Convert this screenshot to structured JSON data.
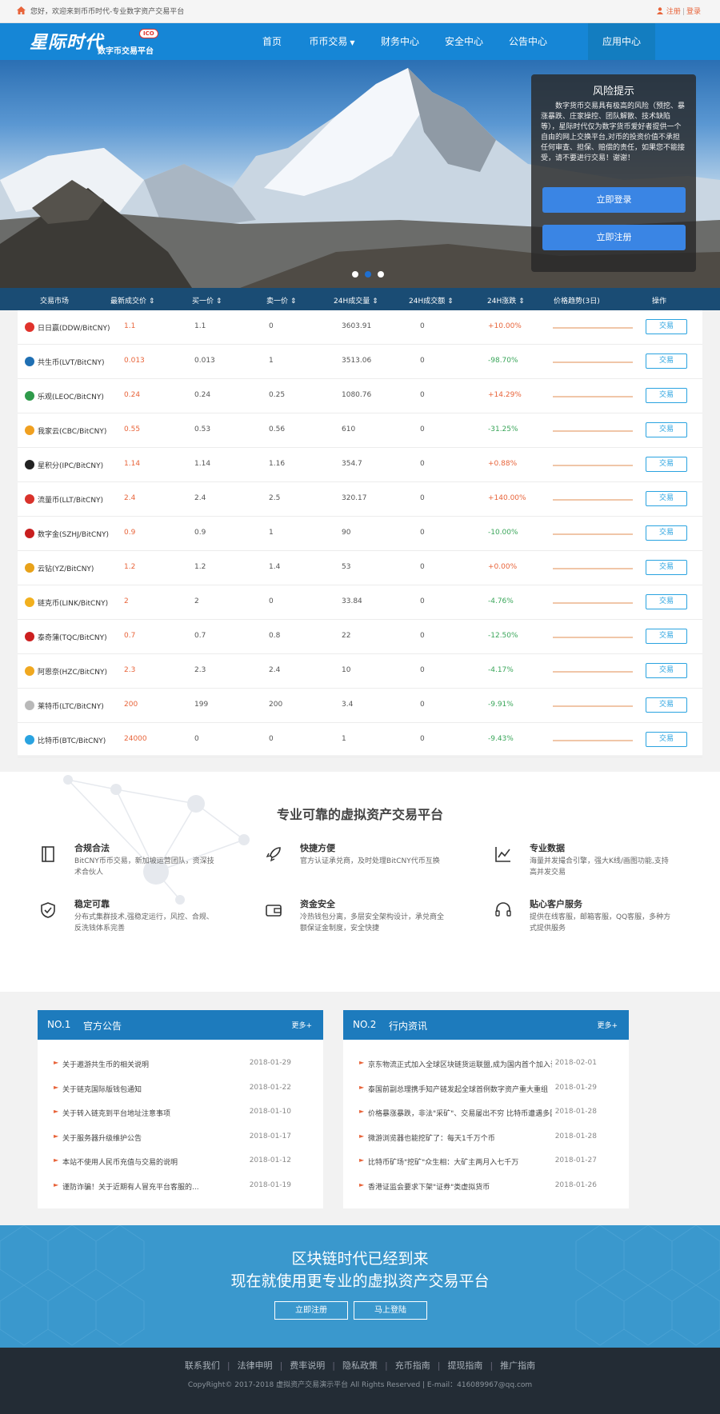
{
  "topbar": {
    "welcome": "您好，欢迎来到币币时代-专业数字资产交易平台",
    "register": "注册",
    "login": "登录"
  },
  "nav": {
    "logo_main": "星际时代",
    "logo_sub": "数字币交易平台",
    "logo_badge": "ICO",
    "items": [
      "首页",
      "币币交易",
      "财务中心",
      "安全中心",
      "公告中心",
      "应用中心"
    ]
  },
  "hero": {
    "risk_title": "风险提示",
    "risk_text": "数字货币交易具有极高的风险（预挖、暴涨暴跌、庄家操控、团队解散、技术缺陷等），星际时代仅为数字货币爱好者提供一个自由的网上交换平台,对币的投资价值不承担任何审查、担保、赔偿的责任，如果您不能接受，请不要进行交易！谢谢！",
    "login_button": "立即登录",
    "register_button": "立即注册"
  },
  "market": {
    "headers": [
      "交易市场",
      "最新成交价 ⇕",
      "买一价 ⇕",
      "卖一价 ⇕",
      "24H成交量 ⇕",
      "24H成交额 ⇕",
      "24H涨跌 ⇕",
      "价格趋势(3日)",
      "操作"
    ],
    "trade_label": "交易",
    "rows": [
      {
        "name": "日日赢(DDW/BitCNY)",
        "last": "1.1",
        "buy": "1.1",
        "sell": "0",
        "vol": "3603.91",
        "amt": "0",
        "chg": "+10.00%",
        "dir": "up",
        "color": "#e0332c"
      },
      {
        "name": "共生币(LVT/BitCNY)",
        "last": "0.013",
        "buy": "0.013",
        "sell": "1",
        "vol": "3513.06",
        "amt": "0",
        "chg": "-98.70%",
        "dir": "down",
        "color": "#1f6fb3"
      },
      {
        "name": "乐观(LEOC/BitCNY)",
        "last": "0.24",
        "buy": "0.24",
        "sell": "0.25",
        "vol": "1080.76",
        "amt": "0",
        "chg": "+14.29%",
        "dir": "up",
        "color": "#2e9a4a"
      },
      {
        "name": "我家云(CBC/BitCNY)",
        "last": "0.55",
        "buy": "0.53",
        "sell": "0.56",
        "vol": "610",
        "amt": "0",
        "chg": "-31.25%",
        "dir": "down",
        "color": "#f0a020"
      },
      {
        "name": "星积分(IPC/BitCNY)",
        "last": "1.14",
        "buy": "1.14",
        "sell": "1.16",
        "vol": "354.7",
        "amt": "0",
        "chg": "+0.88%",
        "dir": "up",
        "color": "#222222"
      },
      {
        "name": "流量币(LLT/BitCNY)",
        "last": "2.4",
        "buy": "2.4",
        "sell": "2.5",
        "vol": "320.17",
        "amt": "0",
        "chg": "+140.00%",
        "dir": "up",
        "color": "#d9322b"
      },
      {
        "name": "数字金(SZHJ/BitCNY)",
        "last": "0.9",
        "buy": "0.9",
        "sell": "1",
        "vol": "90",
        "amt": "0",
        "chg": "-10.00%",
        "dir": "down",
        "color": "#c81e1e"
      },
      {
        "name": "云钻(YZ/BitCNY)",
        "last": "1.2",
        "buy": "1.2",
        "sell": "1.4",
        "vol": "53",
        "amt": "0",
        "chg": "+0.00%",
        "dir": "up",
        "color": "#e8a21a"
      },
      {
        "name": "链克币(LINK/BitCNY)",
        "last": "2",
        "buy": "2",
        "sell": "0",
        "vol": "33.84",
        "amt": "0",
        "chg": "-4.76%",
        "dir": "down",
        "color": "#f2b01e"
      },
      {
        "name": "泰奇蒲(TQC/BitCNY)",
        "last": "0.7",
        "buy": "0.7",
        "sell": "0.8",
        "vol": "22",
        "amt": "0",
        "chg": "-12.50%",
        "dir": "down",
        "color": "#cc1f1f"
      },
      {
        "name": "阿恩奈(HZC/BitCNY)",
        "last": "2.3",
        "buy": "2.3",
        "sell": "2.4",
        "vol": "10",
        "amt": "0",
        "chg": "-4.17%",
        "dir": "down",
        "color": "#f0a820"
      },
      {
        "name": "莱特币(LTC/BitCNY)",
        "last": "200",
        "buy": "199",
        "sell": "200",
        "vol": "3.4",
        "amt": "0",
        "chg": "-9.91%",
        "dir": "down",
        "color": "#b9b9b9"
      },
      {
        "name": "比特币(BTC/BitCNY)",
        "last": "24000",
        "buy": "0",
        "sell": "0",
        "vol": "1",
        "amt": "0",
        "chg": "-9.43%",
        "dir": "down",
        "color": "#2aa3e0"
      }
    ]
  },
  "features": {
    "title": "专业可靠的虚拟资产交易平台",
    "items": [
      {
        "name": "合规合法",
        "desc": "BitCNY币币交易，新加坡运营团队，资深技术合伙人",
        "icon": "book-icon"
      },
      {
        "name": "快捷方便",
        "desc": "官方认证承兑商，及时处理BitCNY代币互换",
        "icon": "rocket-icon"
      },
      {
        "name": "专业数据",
        "desc": "海量并发撮合引擎，强大K线/画图功能,支持高并发交易",
        "icon": "chart-icon"
      },
      {
        "name": "稳定可靠",
        "desc": "分布式集群技术,强稳定运行，风控、合规、反洗钱体系完善",
        "icon": "shield-icon"
      },
      {
        "name": "资金安全",
        "desc": "冷热钱包分离，多层安全架构设计，承兑商全额保证金制度，安全快捷",
        "icon": "wallet-icon"
      },
      {
        "name": "贴心客户服务",
        "desc": "提供在线客服，邮箱客服，QQ客服，多种方式提供服务",
        "icon": "headset-icon"
      }
    ]
  },
  "news": [
    {
      "no": "NO.1",
      "title": "官方公告",
      "more": "更多+",
      "items": [
        {
          "t": "关于邀游共生币的相关说明",
          "d": "2018-01-29"
        },
        {
          "t": "关于链克国际版钱包通知",
          "d": "2018-01-22"
        },
        {
          "t": "关于转入链克到平台地址注意事项",
          "d": "2018-01-10"
        },
        {
          "t": "关于服务器升级维护公告",
          "d": "2018-01-17"
        },
        {
          "t": "本站不使用人民币充值与交易的说明",
          "d": "2018-01-12"
        },
        {
          "t": "谨防诈骗！关于近期有人冒充平台客服的...",
          "d": "2018-01-19"
        }
      ]
    },
    {
      "no": "NO.2",
      "title": "行内资讯",
      "more": "更多+",
      "items": [
        {
          "t": "京东物流正式加入全球区块链货运联盟,成为国内首个加入该联盟的物...",
          "d": "2018-02-01"
        },
        {
          "t": "泰国前副总理携手知产链发起全球首例数字资产重大重组",
          "d": "2018-01-29"
        },
        {
          "t": "价格暴涨暴跌，非法\"采矿\"、交易屡出不穷 比特币遭遇多国监管高压",
          "d": "2018-01-28"
        },
        {
          "t": "微游浏览器也能挖矿了：每天1千万个币",
          "d": "2018-01-28"
        },
        {
          "t": "比特币矿场\"挖矿\"众生相：大矿主两月入七千万",
          "d": "2018-01-27"
        },
        {
          "t": "香港证监会要求下架\"证券\"类虚拟货币",
          "d": "2018-01-26"
        }
      ]
    }
  ],
  "cta": {
    "line1": "区块链时代已经到来",
    "line2": "现在就使用更专业的虚拟资产交易平台",
    "register": "立即注册",
    "login": "马上登陆"
  },
  "footer": {
    "links": [
      "联系我们",
      "法律申明",
      "费率说明",
      "隐私政策",
      "充币指南",
      "提现指南",
      "推广指南"
    ],
    "copyright": "CopyRight© 2017-2018 虚拟资产交易演示平台 All Rights Reserved | E-mail：416089967@qq.com"
  }
}
